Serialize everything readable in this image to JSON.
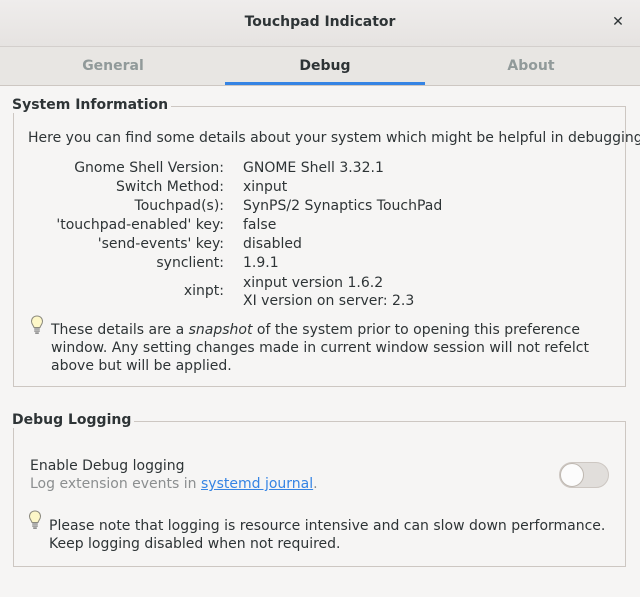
{
  "window": {
    "title": "Touchpad Indicator",
    "close_glyph": "✕"
  },
  "tabs": [
    {
      "label": "General",
      "active": false
    },
    {
      "label": "Debug",
      "active": true
    },
    {
      "label": "About",
      "active": false
    }
  ],
  "system_info": {
    "heading": "System Information",
    "intro": "Here you can find some details about your system which might be helpful in debugging.",
    "rows": [
      {
        "key": "Gnome Shell Version:",
        "value": "GNOME Shell 3.32.1"
      },
      {
        "key": "Switch Method:",
        "value": "xinput"
      },
      {
        "key": "Touchpad(s):",
        "value": "SynPS/2 Synaptics TouchPad"
      },
      {
        "key": "'touchpad-enabled' key:",
        "value": "false"
      },
      {
        "key": "'send-events' key:",
        "value": "disabled"
      },
      {
        "key": "synclient:",
        "value": "1.9.1"
      }
    ],
    "xinpt": {
      "key": "xinpt:",
      "line1": "xinput version 1.6.2",
      "line2": "XI version on server: 2.3"
    },
    "note": {
      "icon": "lightbulb-icon",
      "before": "These details are a ",
      "emphasis": "snapshot",
      "after": " of the system prior to opening this preference window. Any setting changes made in current window session will not refelct above but will be applied."
    }
  },
  "debug_logging": {
    "heading": "Debug Logging",
    "enable_label": "Enable Debug logging",
    "sub_before": "Log extension events in ",
    "sub_link": "systemd journal",
    "sub_after": ".",
    "toggle_on": false,
    "note_icon": "lightbulb-icon",
    "note": "Please note that logging is resource intensive and can slow down performance. Keep logging disabled when not required."
  },
  "colors": {
    "accent": "#3584e4",
    "background": "#f6f5f4",
    "muted_text": "#8b8e8f"
  }
}
